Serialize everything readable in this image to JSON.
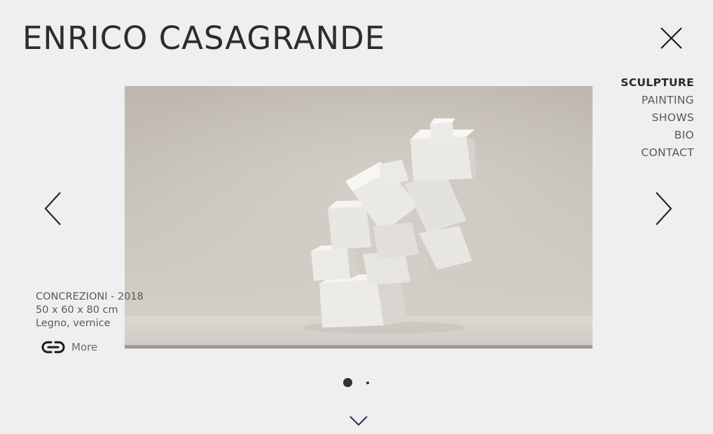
{
  "site": {
    "title": "ENRICO CASAGRANDE"
  },
  "menu": {
    "items": [
      {
        "label": "SCULPTURE",
        "active": true
      },
      {
        "label": "PAINTING",
        "active": false
      },
      {
        "label": "SHOWS",
        "active": false
      },
      {
        "label": "BIO",
        "active": false
      },
      {
        "label": "CONTACT",
        "active": false
      }
    ]
  },
  "artwork": {
    "title": "CONCREZIONI - 2018",
    "dimensions": "50 x 60 x 80 cm",
    "materials": "Legno, vernice",
    "more_label": "More"
  },
  "slider": {
    "slide_count": 2,
    "current_slide": 1
  },
  "icons": {
    "close": "close-icon",
    "prev": "chevron-left-icon",
    "next": "chevron-right-icon",
    "link": "link-icon",
    "scroll": "chevron-down-icon"
  },
  "colors": {
    "background": "#efefef",
    "text": "#333333",
    "scroll_chevron": "#2a2d55"
  }
}
